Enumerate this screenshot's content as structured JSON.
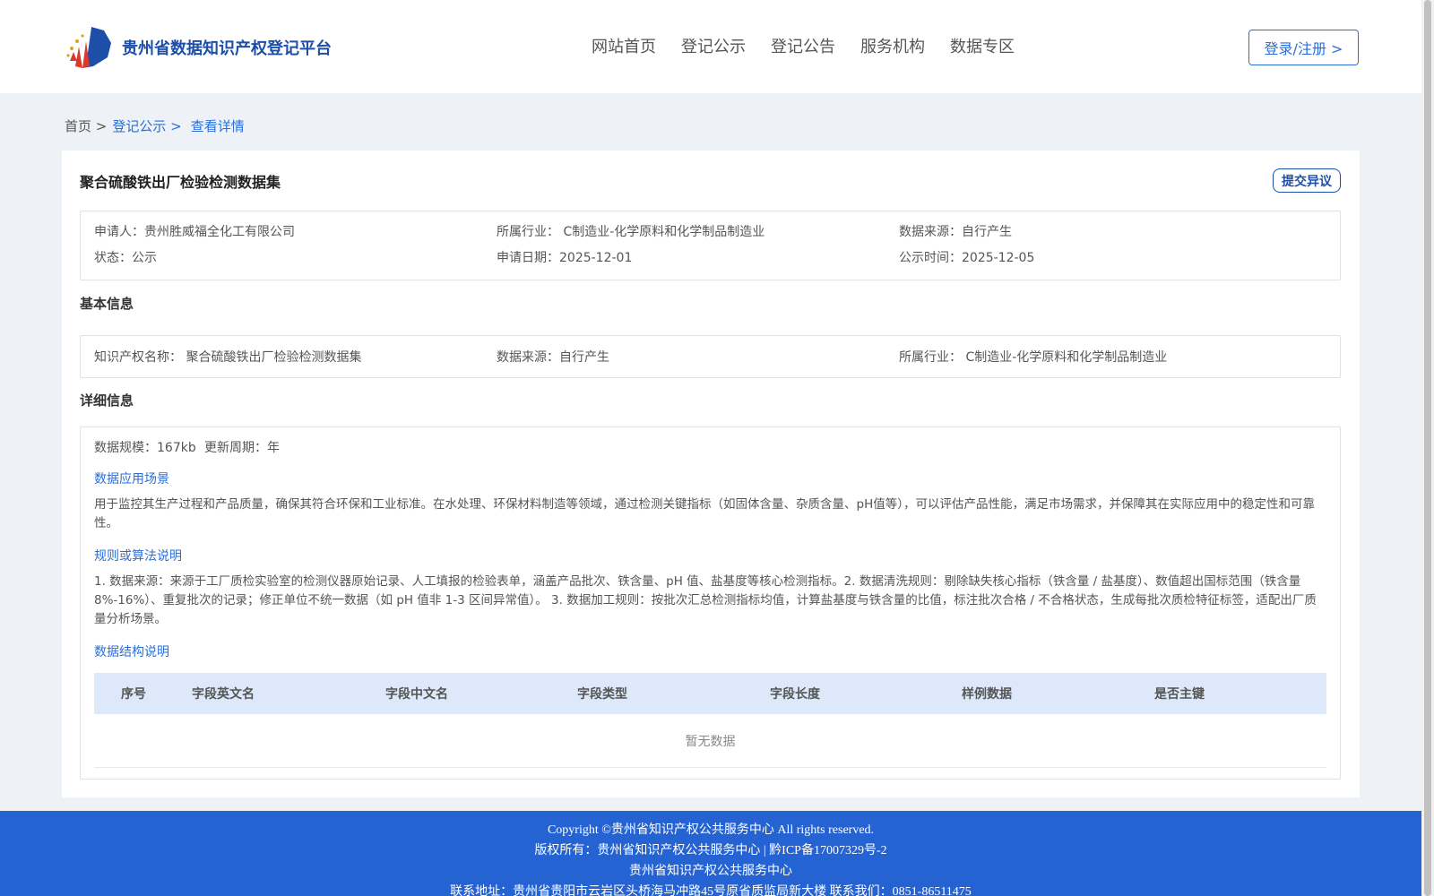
{
  "header": {
    "logo_text": "贵州省数据知识产权登记平台",
    "nav": [
      "网站首页",
      "登记公示",
      "登记公告",
      "服务机构",
      "数据专区"
    ],
    "login_label": "登录/注册 >"
  },
  "breadcrumb": {
    "home": "首页 >",
    "list": "登记公示 >",
    "current": "查看详情"
  },
  "detail": {
    "title": "聚合硫酸铁出厂检验检测数据集",
    "objection_label": "提交异议",
    "summary": {
      "applicant_label": "申请人：",
      "applicant": "贵州胜威福全化工有限公司",
      "industry_label": "所属行业：",
      "industry": "C制造业-化学原料和化学制品制造业",
      "source_label": "数据来源：",
      "source": "自行产生",
      "status_label": "状态：",
      "status": "公示",
      "apply_date_label": "申请日期：",
      "apply_date": "2025-12-01",
      "publish_date_label": "公示时间：",
      "publish_date": "2025-12-05"
    },
    "basic_heading": "基本信息",
    "basic": {
      "ip_name_label": "知识产权名称：",
      "ip_name": "聚合硫酸铁出厂检验检测数据集",
      "source_label": "数据来源：",
      "source": "自行产生",
      "industry_label": "所属行业：",
      "industry": "C制造业-化学原料和化学制品制造业"
    },
    "detail_heading": "详细信息",
    "scale_label": "数据规模：",
    "scale": "167kb",
    "cycle_label": "更新周期：",
    "cycle": "年",
    "scenario_heading": "数据应用场景",
    "scenario_text": "用于监控其生产过程和产品质量，确保其符合环保和工业标准。在水处理、环保材料制造等领域，通过检测关键指标（如固体含量、杂质含量、pH值等），可以评估产品性能，满足市场需求，并保障其在实际应用中的稳定性和可靠性。",
    "rules_heading": "规则或算法说明",
    "rules_text": "1. 数据来源：来源于工厂质检实验室的检测仪器原始记录、人工填报的检验表单，涵盖产品批次、铁含量、pH 值、盐基度等核心检测指标。2. 数据清洗规则：剔除缺失核心指标（铁含量 / 盐基度）、数值超出国标范围（铁含量 8%-16%）、重复批次的记录；修正单位不统一数据（如 pH 值非 1-3 区间异常值）。 3. 数据加工规则：按批次汇总检测指标均值，计算盐基度与铁含量的比值，标注批次合格 / 不合格状态，生成每批次质检特征标签，适配出厂质量分析场景。",
    "structure_heading": "数据结构说明",
    "table_headers": [
      "序号",
      "字段英文名",
      "字段中文名",
      "字段类型",
      "字段长度",
      "样例数据",
      "是否主键"
    ],
    "empty_text": "暂无数据"
  },
  "footer": {
    "line1": "Copyright ©贵州省知识产权公共服务中心 All rights reserved.",
    "line2": "版权所有：贵州省知识产权公共服务中心 | 黔ICP备17007329号-2",
    "line3": "贵州省知识产权公共服务中心",
    "line4": "联系地址：贵州省贵阳市云岩区头桥海马冲路45号原省质监局新大楼 联系我们：0851-86511475"
  }
}
